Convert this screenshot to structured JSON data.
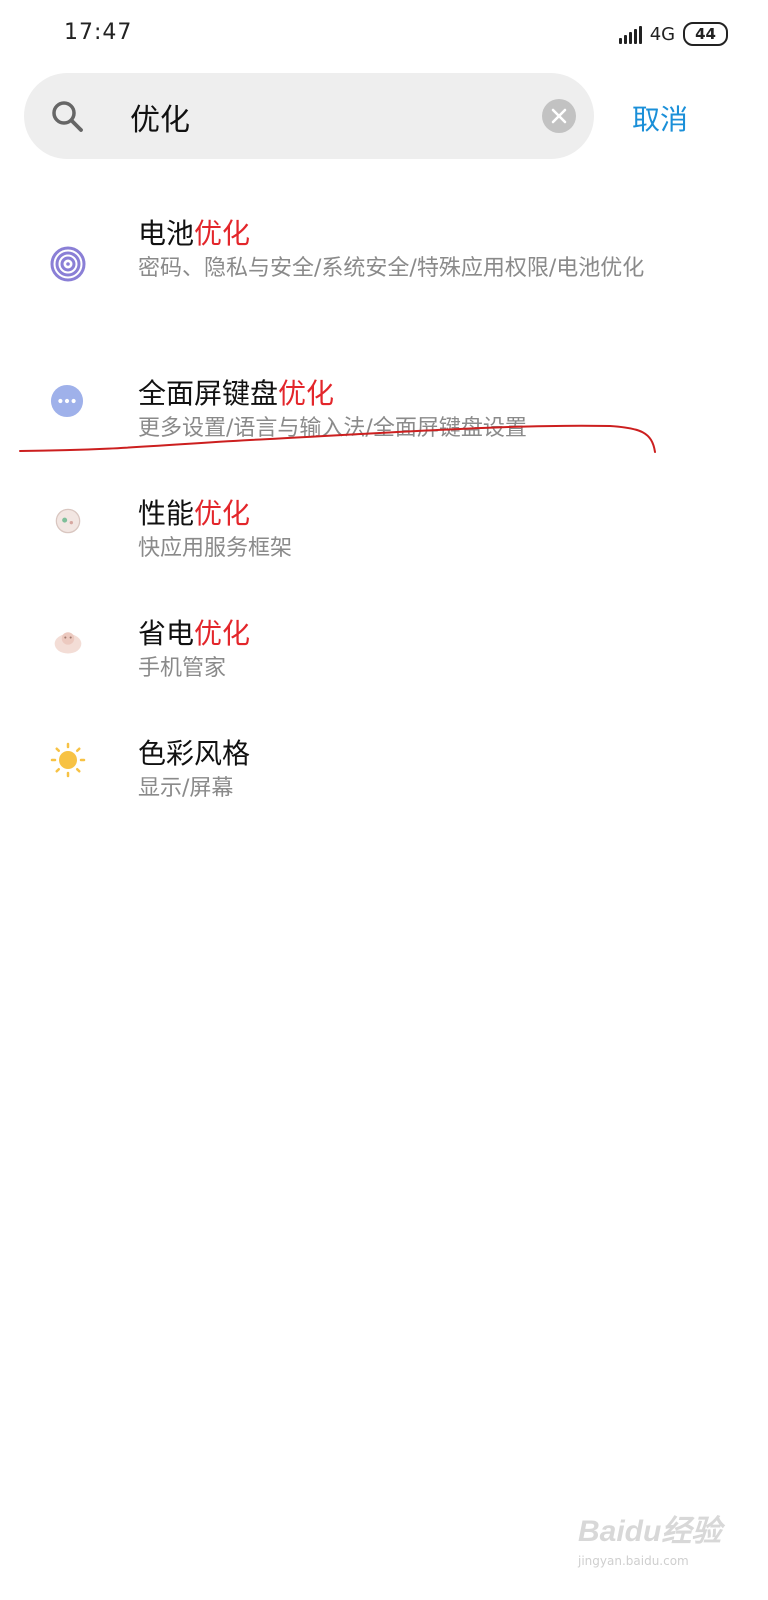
{
  "status_bar": {
    "time": "17:47",
    "network": "4G",
    "battery": "44"
  },
  "search": {
    "query": "优化",
    "cancel_label": "取消",
    "icons": [
      "search-icon",
      "clear-icon"
    ]
  },
  "results": [
    {
      "title_prefix": "电池",
      "title_highlight": "优化",
      "title_suffix": "",
      "path": "密码、隐私与安全/系统安全/特殊应用权限/电池优化",
      "icon": "fingerprint-icon",
      "icon_color": "#8a7fd6"
    },
    {
      "title_prefix": "全面屏键盘",
      "title_highlight": "优化",
      "title_suffix": "",
      "path": "更多设置/语言与输入法/全面屏键盘设置",
      "icon": "more-dots-icon",
      "icon_color": "#9fb1ea"
    },
    {
      "title_prefix": "性能",
      "title_highlight": "优化",
      "title_suffix": "",
      "path": "快应用服务框架",
      "icon": "app-framework-icon",
      "icon_color": "#e9dcd6"
    },
    {
      "title_prefix": "省电",
      "title_highlight": "优化",
      "title_suffix": "",
      "path": "手机管家",
      "icon": "phone-manager-icon",
      "icon_color": "#efd7cf"
    },
    {
      "title_prefix": "色彩风格",
      "title_highlight": "",
      "title_suffix": "",
      "path": "显示/屏幕",
      "icon": "sun-icon",
      "icon_color": "#f7c244"
    }
  ],
  "colors": {
    "highlight": "#e3262b",
    "accent": "#1a8fd8",
    "annotation": "#cc1f1f"
  },
  "watermark": {
    "logo": "Baidu经验",
    "url": "jingyan.baidu.com"
  }
}
